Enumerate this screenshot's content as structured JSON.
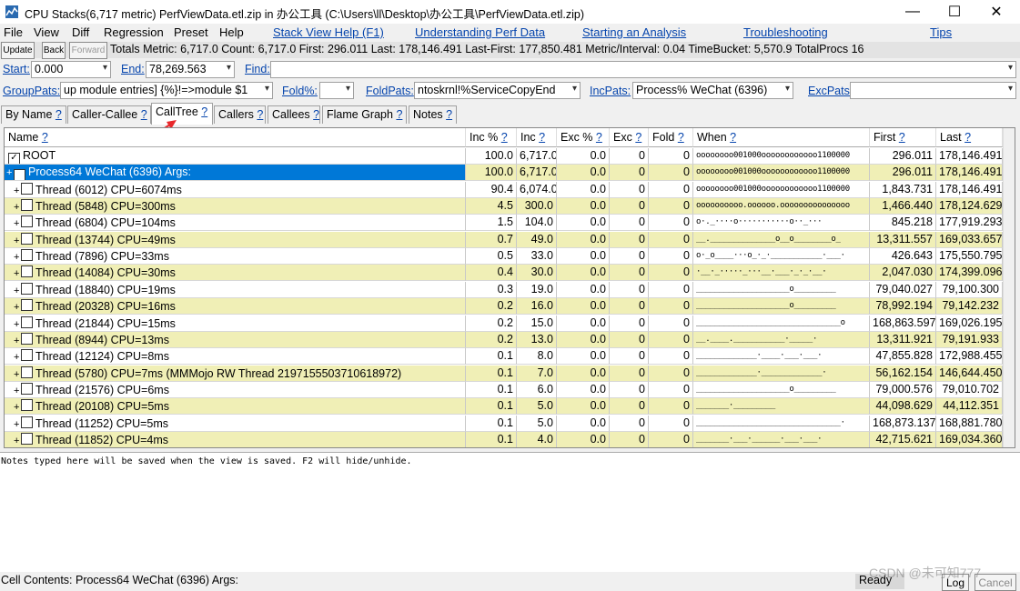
{
  "window": {
    "title": "CPU Stacks(6,717 metric) PerfViewData.etl.zip in 办公工具 (C:\\Users\\ll\\Desktop\\办公工具\\PerfViewData.etl.zip)",
    "minimize": "—",
    "maximize": "☐",
    "close": "✕"
  },
  "menu": {
    "items": [
      "File",
      "View",
      "Diff",
      "Regression",
      "Preset",
      "Help"
    ],
    "links": [
      "Stack View Help (F1)",
      "Understanding Perf Data",
      "Starting an Analysis",
      "Troubleshooting",
      "Tips"
    ]
  },
  "toolbar": {
    "update": "Update",
    "back": "Back",
    "forward": "Forward",
    "stats": "Totals Metric: 6,717.0  Count: 6,717.0  First: 296.011  Last: 178,146.491  Last-First: 177,850.481  Metric/Interval: 0.04  TimeBucket: 5,570.9  TotalProcs 16"
  },
  "range": {
    "start_label": "Start:",
    "start_value": "0.000",
    "end_label": "End:",
    "end_value": "78,269.563",
    "find_label": "Find:",
    "find_value": ""
  },
  "filters": {
    "grouppats_label": "GroupPats:",
    "grouppats_value": "up module entries]  {%}!=>module $1",
    "fold_label": "Fold%:",
    "fold_value": "",
    "foldpats_label": "FoldPats:",
    "foldpats_value": "ntoskrnl!%ServiceCopyEnd",
    "incpats_label": "IncPats:",
    "incpats_value": "Process% WeChat (6396)",
    "excpats_label": "ExcPats:",
    "excpats_value": ""
  },
  "tabs": [
    "By Name",
    "Caller-Callee",
    "CallTree",
    "Callers",
    "Callees",
    "Flame Graph",
    "Notes"
  ],
  "tab_help": "?",
  "columns": [
    "Name",
    "Inc %",
    "Inc",
    "Exc %",
    "Exc",
    "Fold",
    "When",
    "First",
    "Last"
  ],
  "rows": [
    {
      "exp": "",
      "checked": true,
      "name": "ROOT",
      "inc_pct": "100.0",
      "inc": "6,717.0",
      "exc_pct": "0.0",
      "exc": "0",
      "fold": "0",
      "when": "oooooooo001000oooooooooooo1100000",
      "first": "296.011",
      "last": "178,146.491",
      "hl": false
    },
    {
      "exp": "+",
      "checked": true,
      "name": "Process64 WeChat (6396) Args:",
      "inc_pct": "100.0",
      "inc": "6,717.0",
      "exc_pct": "0.0",
      "exc": "0",
      "fold": "0",
      "when": "oooooooo001000oooooooooooo1100000",
      "first": "296.011",
      "last": "178,146.491",
      "hl": true
    },
    {
      "exp": "+",
      "checked": false,
      "name": "Thread (6012) CPU=6074ms",
      "inc_pct": "90.4",
      "inc": "6,074.0",
      "exc_pct": "0.0",
      "exc": "0",
      "fold": "0",
      "when": "oooooooo001000oooooooooooo1100000",
      "first": "1,843.731",
      "last": "178,146.491",
      "hl": false
    },
    {
      "exp": "+",
      "checked": false,
      "name": "Thread (5848) CPU=300ms",
      "inc_pct": "4.5",
      "inc": "300.0",
      "exc_pct": "0.0",
      "exc": "0",
      "fold": "0",
      "when": "oooooooooo.oooooo.ooooooooooooooo",
      "first": "1,466.440",
      "last": "178,124.629",
      "hl": false
    },
    {
      "exp": "+",
      "checked": false,
      "name": "Thread (6804) CPU=104ms",
      "inc_pct": "1.5",
      "inc": "104.0",
      "exc_pct": "0.0",
      "exc": "0",
      "fold": "0",
      "when": "o·._····o···········o··_···",
      "first": "845.218",
      "last": "177,919.293",
      "hl": false
    },
    {
      "exp": "+",
      "checked": false,
      "name": "Thread (13744) CPU=49ms",
      "inc_pct": "0.7",
      "inc": "49.0",
      "exc_pct": "0.0",
      "exc": "0",
      "fold": "0",
      "when": "__.______________o__o________o_",
      "first": "13,311.557",
      "last": "169,033.657",
      "hl": false
    },
    {
      "exp": "+",
      "checked": false,
      "name": "Thread (7896) CPU=33ms",
      "inc_pct": "0.5",
      "inc": "33.0",
      "exc_pct": "0.0",
      "exc": "0",
      "fold": "0",
      "when": "o·_o____···o_·_·___________·___·",
      "first": "426.643",
      "last": "175,550.795",
      "hl": false
    },
    {
      "exp": "+",
      "checked": false,
      "name": "Thread (14084) CPU=30ms",
      "inc_pct": "0.4",
      "inc": "30.0",
      "exc_pct": "0.0",
      "exc": "0",
      "fold": "0",
      "when": "·__·_·····_···__·___·_·_·__·",
      "first": "2,047.030",
      "last": "174,399.096",
      "hl": false
    },
    {
      "exp": "+",
      "checked": false,
      "name": "Thread (18840) CPU=19ms",
      "inc_pct": "0.3",
      "inc": "19.0",
      "exc_pct": "0.0",
      "exc": "0",
      "fold": "0",
      "when": "____________________o_________",
      "first": "79,040.027",
      "last": "79,100.300",
      "hl": false
    },
    {
      "exp": "+",
      "checked": false,
      "name": "Thread (20328) CPU=16ms",
      "inc_pct": "0.2",
      "inc": "16.0",
      "exc_pct": "0.0",
      "exc": "0",
      "fold": "0",
      "when": "____________________o_________",
      "first": "78,992.194",
      "last": "79,142.232",
      "hl": false
    },
    {
      "exp": "+",
      "checked": false,
      "name": "Thread (21844) CPU=15ms",
      "inc_pct": "0.2",
      "inc": "15.0",
      "exc_pct": "0.0",
      "exc": "0",
      "fold": "0",
      "when": "_______________________________o",
      "first": "168,863.597",
      "last": "169,026.195",
      "hl": false
    },
    {
      "exp": "+",
      "checked": false,
      "name": "Thread (8944) CPU=13ms",
      "inc_pct": "0.2",
      "inc": "13.0",
      "exc_pct": "0.0",
      "exc": "0",
      "fold": "0",
      "when": "__.____.___________·_____·",
      "first": "13,311.921",
      "last": "79,191.933",
      "hl": false
    },
    {
      "exp": "+",
      "checked": false,
      "name": "Thread (12124) CPU=8ms",
      "inc_pct": "0.1",
      "inc": "8.0",
      "exc_pct": "0.0",
      "exc": "0",
      "fold": "0",
      "when": "_____________·____·___·___·",
      "first": "47,855.828",
      "last": "172,988.455",
      "hl": false
    },
    {
      "exp": "+",
      "checked": false,
      "name": "Thread (5780) CPU=7ms (MMMojo RW Thread 2197155503710618972)",
      "inc_pct": "0.1",
      "inc": "7.0",
      "exc_pct": "0.0",
      "exc": "0",
      "fold": "0",
      "when": "_____________·_____________·",
      "first": "56,162.154",
      "last": "146,644.450",
      "hl": false
    },
    {
      "exp": "+",
      "checked": false,
      "name": "Thread (21576) CPU=6ms",
      "inc_pct": "0.1",
      "inc": "6.0",
      "exc_pct": "0.0",
      "exc": "0",
      "fold": "0",
      "when": "____________________o_________",
      "first": "79,000.576",
      "last": "79,010.702",
      "hl": false
    },
    {
      "exp": "+",
      "checked": false,
      "name": "Thread (20108) CPU=5ms",
      "inc_pct": "0.1",
      "inc": "5.0",
      "exc_pct": "0.0",
      "exc": "0",
      "fold": "0",
      "when": "_______·_________",
      "first": "44,098.629",
      "last": "44,112.351",
      "hl": false
    },
    {
      "exp": "+",
      "checked": false,
      "name": "Thread (11252) CPU=5ms",
      "inc_pct": "0.1",
      "inc": "5.0",
      "exc_pct": "0.0",
      "exc": "0",
      "fold": "0",
      "when": "_______________________________·",
      "first": "168,873.137",
      "last": "168,881.780",
      "hl": false
    },
    {
      "exp": "+",
      "checked": false,
      "name": "Thread (11852) CPU=4ms",
      "inc_pct": "0.1",
      "inc": "4.0",
      "exc_pct": "0.0",
      "exc": "0",
      "fold": "0",
      "when": "_______·___·______·___·___·",
      "first": "42,715.621",
      "last": "169,034.360",
      "hl": false
    }
  ],
  "notes_text": "Notes typed here will be saved when the view is saved. F2 will hide/unhide.",
  "status": {
    "cell_contents": "Cell Contents: Process64 WeChat (6396) Args:",
    "ready": "Ready",
    "log": "Log",
    "cancel": "Cancel",
    "watermark": "CSDN @未可知777"
  },
  "colors": {
    "highlight_yellow": "#f0efb6",
    "selected_blue": "#0078d7",
    "link_blue": "#0645ad"
  }
}
